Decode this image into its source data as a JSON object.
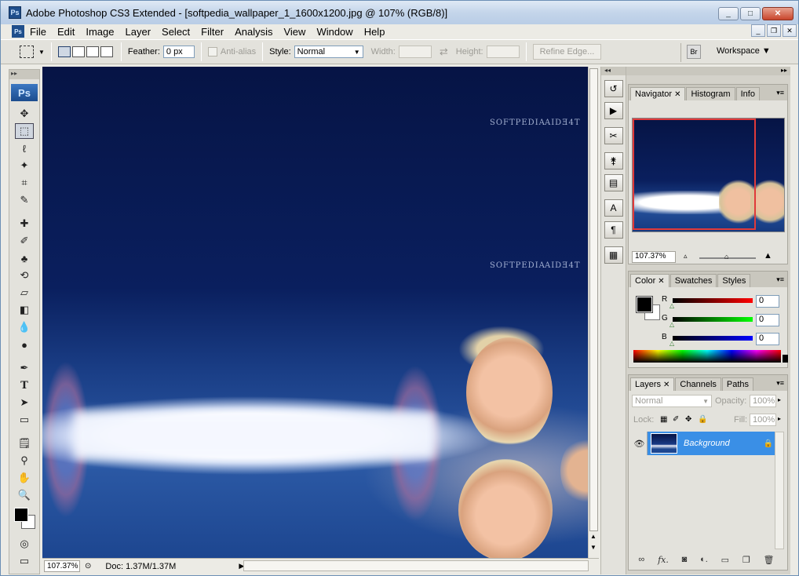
{
  "window": {
    "title": "Adobe Photoshop CS3 Extended - [softpedia_wallpaper_1_1600x1200.jpg @ 107% (RGB/8)]",
    "app_icon": "Ps",
    "minimize": "_",
    "maximize": "□",
    "close": "✕"
  },
  "menubar": {
    "logo": "Ps",
    "items": [
      "File",
      "Edit",
      "Image",
      "Layer",
      "Select",
      "Filter",
      "Analysis",
      "View",
      "Window",
      "Help"
    ]
  },
  "options": {
    "feather_label": "Feather:",
    "feather_value": "0 px",
    "antialias_label": "Anti-alias",
    "style_label": "Style:",
    "style_value": "Normal",
    "width_label": "Width:",
    "height_label": "Height:",
    "refine_edge": "Refine Edge...",
    "workspace_label": "Workspace",
    "workspace_caret": "▼",
    "swap_icon": "⇄"
  },
  "toolbox": {
    "logo": "Ps",
    "tools": [
      "move-tool",
      "marquee-tool",
      "lasso-tool",
      "magic-wand-tool",
      "crop-tool",
      "slice-tool",
      "healing-brush-tool",
      "brush-tool",
      "clone-stamp-tool",
      "history-brush-tool",
      "eraser-tool",
      "gradient-tool",
      "blur-tool",
      "dodge-tool",
      "pen-tool",
      "type-tool",
      "path-selection-tool",
      "shape-tool",
      "notes-tool",
      "eyedropper-tool",
      "hand-tool",
      "zoom-tool"
    ],
    "colors": {
      "foreground": "#000000",
      "background": "#ffffff"
    }
  },
  "canvas": {
    "watermarks": [
      "SOFTPEDIA",
      "AIDƎ4T",
      "SOFTPEDIA",
      "AIDƎ4T"
    ]
  },
  "status": {
    "zoom": "107.37%",
    "doc": "Doc: 1.37M/1.37M"
  },
  "navigator": {
    "tabs": [
      "Navigator",
      "Histogram",
      "Info"
    ],
    "zoom": "107.37%"
  },
  "color": {
    "tabs": [
      "Color",
      "Swatches",
      "Styles"
    ],
    "channels": [
      {
        "label": "R",
        "value": "0"
      },
      {
        "label": "G",
        "value": "0"
      },
      {
        "label": "B",
        "value": "0"
      }
    ]
  },
  "layers": {
    "tabs": [
      "Layers",
      "Channels",
      "Paths"
    ],
    "blend_mode": "Normal",
    "opacity_label": "Opacity:",
    "opacity_value": "100%",
    "lock_label": "Lock:",
    "fill_label": "Fill:",
    "fill_value": "100%",
    "layer_name": "Background"
  },
  "accent": "#3a8fe6"
}
